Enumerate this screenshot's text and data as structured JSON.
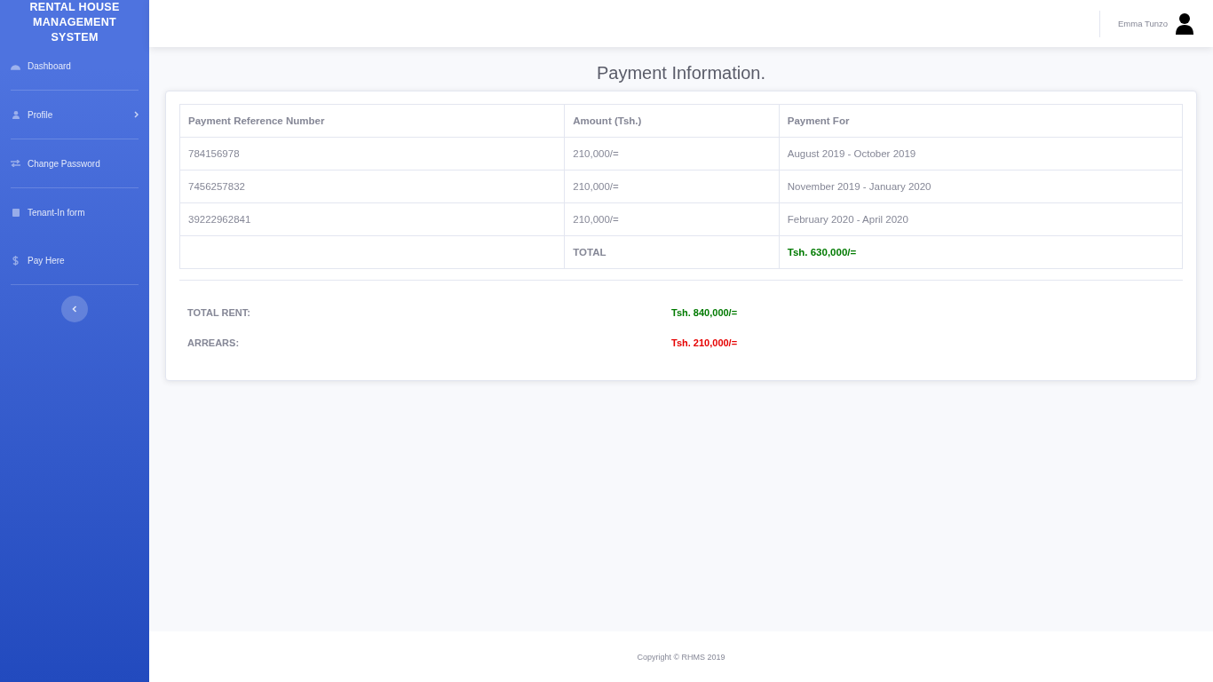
{
  "sidebar": {
    "brand": "RENTAL HOUSE MANAGEMENT SYSTEM",
    "items": [
      {
        "kind": "dashboard",
        "label": "Dashboard",
        "has_submenu": false,
        "divider_after": true
      },
      {
        "kind": "user",
        "label": "Profile",
        "has_submenu": true,
        "divider_after": true
      },
      {
        "kind": "exchange",
        "label": "Change Password",
        "has_submenu": false,
        "divider_after": true
      },
      {
        "kind": "clipboard",
        "label": "Tenant-In form",
        "has_submenu": false,
        "divider_after": false
      },
      {
        "kind": "dollar",
        "label": "Pay Here",
        "has_submenu": false,
        "divider_after": true
      }
    ]
  },
  "topbar": {
    "user_name": "Emma Tunzo"
  },
  "page_title": "Payment Information.",
  "table": {
    "columns": [
      "Payment Reference Number",
      "Amount (Tsh.)",
      "Payment For"
    ],
    "rows": [
      [
        "784156978",
        "210,000/=",
        "August 2019 - October 2019"
      ],
      [
        "7456257832",
        "210,000/=",
        "November 2019 - January 2020"
      ],
      [
        "39222962841",
        "210,000/=",
        "February 2020 - April 2020"
      ]
    ],
    "total": {
      "label": "TOTAL",
      "value": "Tsh. 630,000/=",
      "color": "#007a00"
    }
  },
  "summary": [
    {
      "label": "TOTAL RENT:",
      "value": "Tsh. 840,000/=",
      "color": "#007a00"
    },
    {
      "label": "ARREARS:",
      "value": "Tsh. 210,000/=",
      "color": "#e60000"
    }
  ],
  "footer": "Copyright © RHMS 2019"
}
